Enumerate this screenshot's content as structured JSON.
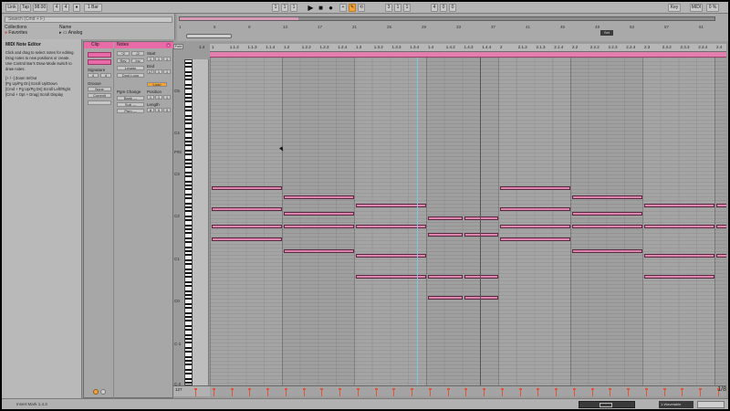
{
  "transport": {
    "link": "Link",
    "tap": "Tap",
    "tempo": "98.00",
    "sig_num": "4",
    "sig_den": "4",
    "metronome": "●",
    "quantize": "1 Bar",
    "position": [
      "1",
      "1",
      "1"
    ],
    "loop_start": [
      "3",
      "1",
      "1"
    ],
    "loop_length": [
      "4",
      "0",
      "0"
    ],
    "key_label": "Key",
    "midi_label": "MIDI",
    "cpu": "0 %"
  },
  "browser": {
    "search_placeholder": "Search (Cmd + F)",
    "collections_header": "Collections",
    "favorites": "Favorites",
    "name_header": "Name",
    "folder_item": "Analog"
  },
  "info": {
    "title": "MIDI Note Editor",
    "body": "Click and drag to select notes for editing. Drag notes to new positions or create. Use Control Bar's Draw Mode switch to draw notes.",
    "shortcuts": "[+ / -] Zoom In/Out\n[Pg Up/Pg Dn] Scroll Up/Down\n[Cmd + Pg Up/Pg Dn] Scroll Left/Right\n[Cmd + Opt + Drag] Scroll Display"
  },
  "clip": {
    "title": "Clip",
    "notes_title": "Notes",
    "signature_label": "Signature",
    "sig_num": "4",
    "sig_den": "4",
    "groove_label": "Groove",
    "groove_value": "None",
    "commit": "Commit",
    "start_label": "Start",
    "start": [
      "1",
      "1",
      "1"
    ],
    "end_label": "End",
    "end": [
      "17",
      "1",
      "1"
    ],
    "loop_label": "Loop",
    "position_label": "Position",
    "position": [
      "1",
      "1",
      "1"
    ],
    "length_label": "Length",
    "length": [
      "8",
      "0",
      "0"
    ],
    "fold_btn": "Fold",
    "double_tempo": "*2",
    "half_tempo": "/2",
    "rev": "Rev",
    "inv": "Inv",
    "legato": "Legato",
    "dupl_loop": "Dupl.Loop",
    "pgm_change": "Pgm Change",
    "bank": "Bank ---",
    "sub": "Sub ---",
    "pgm": "Pgm ---"
  },
  "editor": {
    "fold": "Fold",
    "pitch_labels": [
      "C5",
      "C4",
      "F#3",
      "C3",
      "C2",
      "C1",
      "C0",
      "C-1",
      "C-2"
    ],
    "ruler": [
      "1",
      "1.1.2",
      "1.1.3",
      "1.1.4",
      "1.2",
      "1.2.2",
      "1.2.3",
      "1.2.4",
      "1.3",
      "1.3.2",
      "1.3.3",
      "1.3.4",
      "1.4",
      "1.4.2",
      "1.4.3",
      "1.4.4",
      "2",
      "2.1.2",
      "2.1.3",
      "2.1.4",
      "2.2",
      "2.2.2",
      "2.2.3",
      "2.2.4",
      "2.3",
      "2.3.2",
      "2.3.3",
      "2.3.4",
      "2.4",
      "2.4.2",
      "2.4.3"
    ],
    "ruler_start": "1.4",
    "grid_fraction": "1/8",
    "velocity_label": "127"
  },
  "notes": [
    {
      "s": 0,
      "l": 1,
      "p": 68
    },
    {
      "s": 0,
      "l": 1,
      "p": 67
    },
    {
      "s": 0,
      "l": 1,
      "p": 65
    },
    {
      "s": 0,
      "l": 1,
      "p": 63
    },
    {
      "s": 0,
      "l": 1,
      "p": 61
    },
    {
      "s": 0,
      "l": 1,
      "p": 58
    },
    {
      "s": 0,
      "l": 1,
      "p": 56
    },
    {
      "s": 0,
      "l": 1,
      "p": 53
    },
    {
      "s": 0,
      "l": 1,
      "p": 50
    },
    {
      "s": 0,
      "l": 1,
      "p": 47
    },
    {
      "s": 0,
      "l": 1,
      "p": 45
    },
    {
      "s": 0,
      "l": 1,
      "p": 43
    },
    {
      "s": 0,
      "l": 1,
      "p": 40
    },
    {
      "s": 0,
      "l": 1,
      "p": 38
    },
    {
      "s": 0,
      "l": 1,
      "p": 36
    },
    {
      "s": 0,
      "l": 1,
      "p": 33
    },
    {
      "s": 0,
      "l": 1,
      "p": 31
    },
    {
      "s": 1,
      "l": 4,
      "p": 43
    },
    {
      "s": 1,
      "l": 4,
      "p": 38
    },
    {
      "s": 1,
      "l": 4,
      "p": 34
    },
    {
      "s": 1,
      "l": 4,
      "p": 31
    },
    {
      "s": 5,
      "l": 4,
      "p": 41
    },
    {
      "s": 5,
      "l": 4,
      "p": 37
    },
    {
      "s": 5,
      "l": 4,
      "p": 34
    },
    {
      "s": 5,
      "l": 4,
      "p": 28
    },
    {
      "s": 9,
      "l": 4,
      "p": 39
    },
    {
      "s": 9,
      "l": 4,
      "p": 34
    },
    {
      "s": 9,
      "l": 4,
      "p": 27
    },
    {
      "s": 9,
      "l": 4,
      "p": 22
    },
    {
      "s": 13,
      "l": 2,
      "p": 36
    },
    {
      "s": 13,
      "l": 2,
      "p": 32
    },
    {
      "s": 13,
      "l": 2,
      "p": 22
    },
    {
      "s": 13,
      "l": 2,
      "p": 17
    },
    {
      "s": 15,
      "l": 2,
      "p": 36
    },
    {
      "s": 15,
      "l": 2,
      "p": 32
    },
    {
      "s": 15,
      "l": 2,
      "p": 22
    },
    {
      "s": 15,
      "l": 2,
      "p": 17
    },
    {
      "s": 17,
      "l": 4,
      "p": 43
    },
    {
      "s": 17,
      "l": 4,
      "p": 38
    },
    {
      "s": 17,
      "l": 4,
      "p": 34
    },
    {
      "s": 17,
      "l": 4,
      "p": 31
    },
    {
      "s": 21,
      "l": 4,
      "p": 41
    },
    {
      "s": 21,
      "l": 4,
      "p": 37
    },
    {
      "s": 21,
      "l": 4,
      "p": 34
    },
    {
      "s": 21,
      "l": 4,
      "p": 28
    },
    {
      "s": 25,
      "l": 4,
      "p": 39
    },
    {
      "s": 25,
      "l": 4,
      "p": 34
    },
    {
      "s": 25,
      "l": 4,
      "p": 27
    },
    {
      "s": 25,
      "l": 4,
      "p": 22
    },
    {
      "s": 29,
      "l": 2,
      "p": 39
    },
    {
      "s": 29,
      "l": 2,
      "p": 34
    },
    {
      "s": 29,
      "l": 2,
      "p": 27
    }
  ],
  "velocities": [
    0,
    1,
    2,
    3,
    4,
    5,
    6,
    7,
    8,
    9,
    10,
    11,
    12,
    13,
    14,
    15,
    16,
    17,
    18,
    19,
    20,
    21,
    22,
    23,
    24,
    25,
    26,
    27,
    28,
    29
  ],
  "status": {
    "message": "Insert Mark 1.4.3",
    "track": "1-Wavetable"
  },
  "colors": {
    "note": "#dc84ae",
    "clip_accent": "#e86aa6",
    "transport_active": "#f1a33a",
    "velocity": "#e0543a",
    "playhead": "#7fc7e0"
  }
}
